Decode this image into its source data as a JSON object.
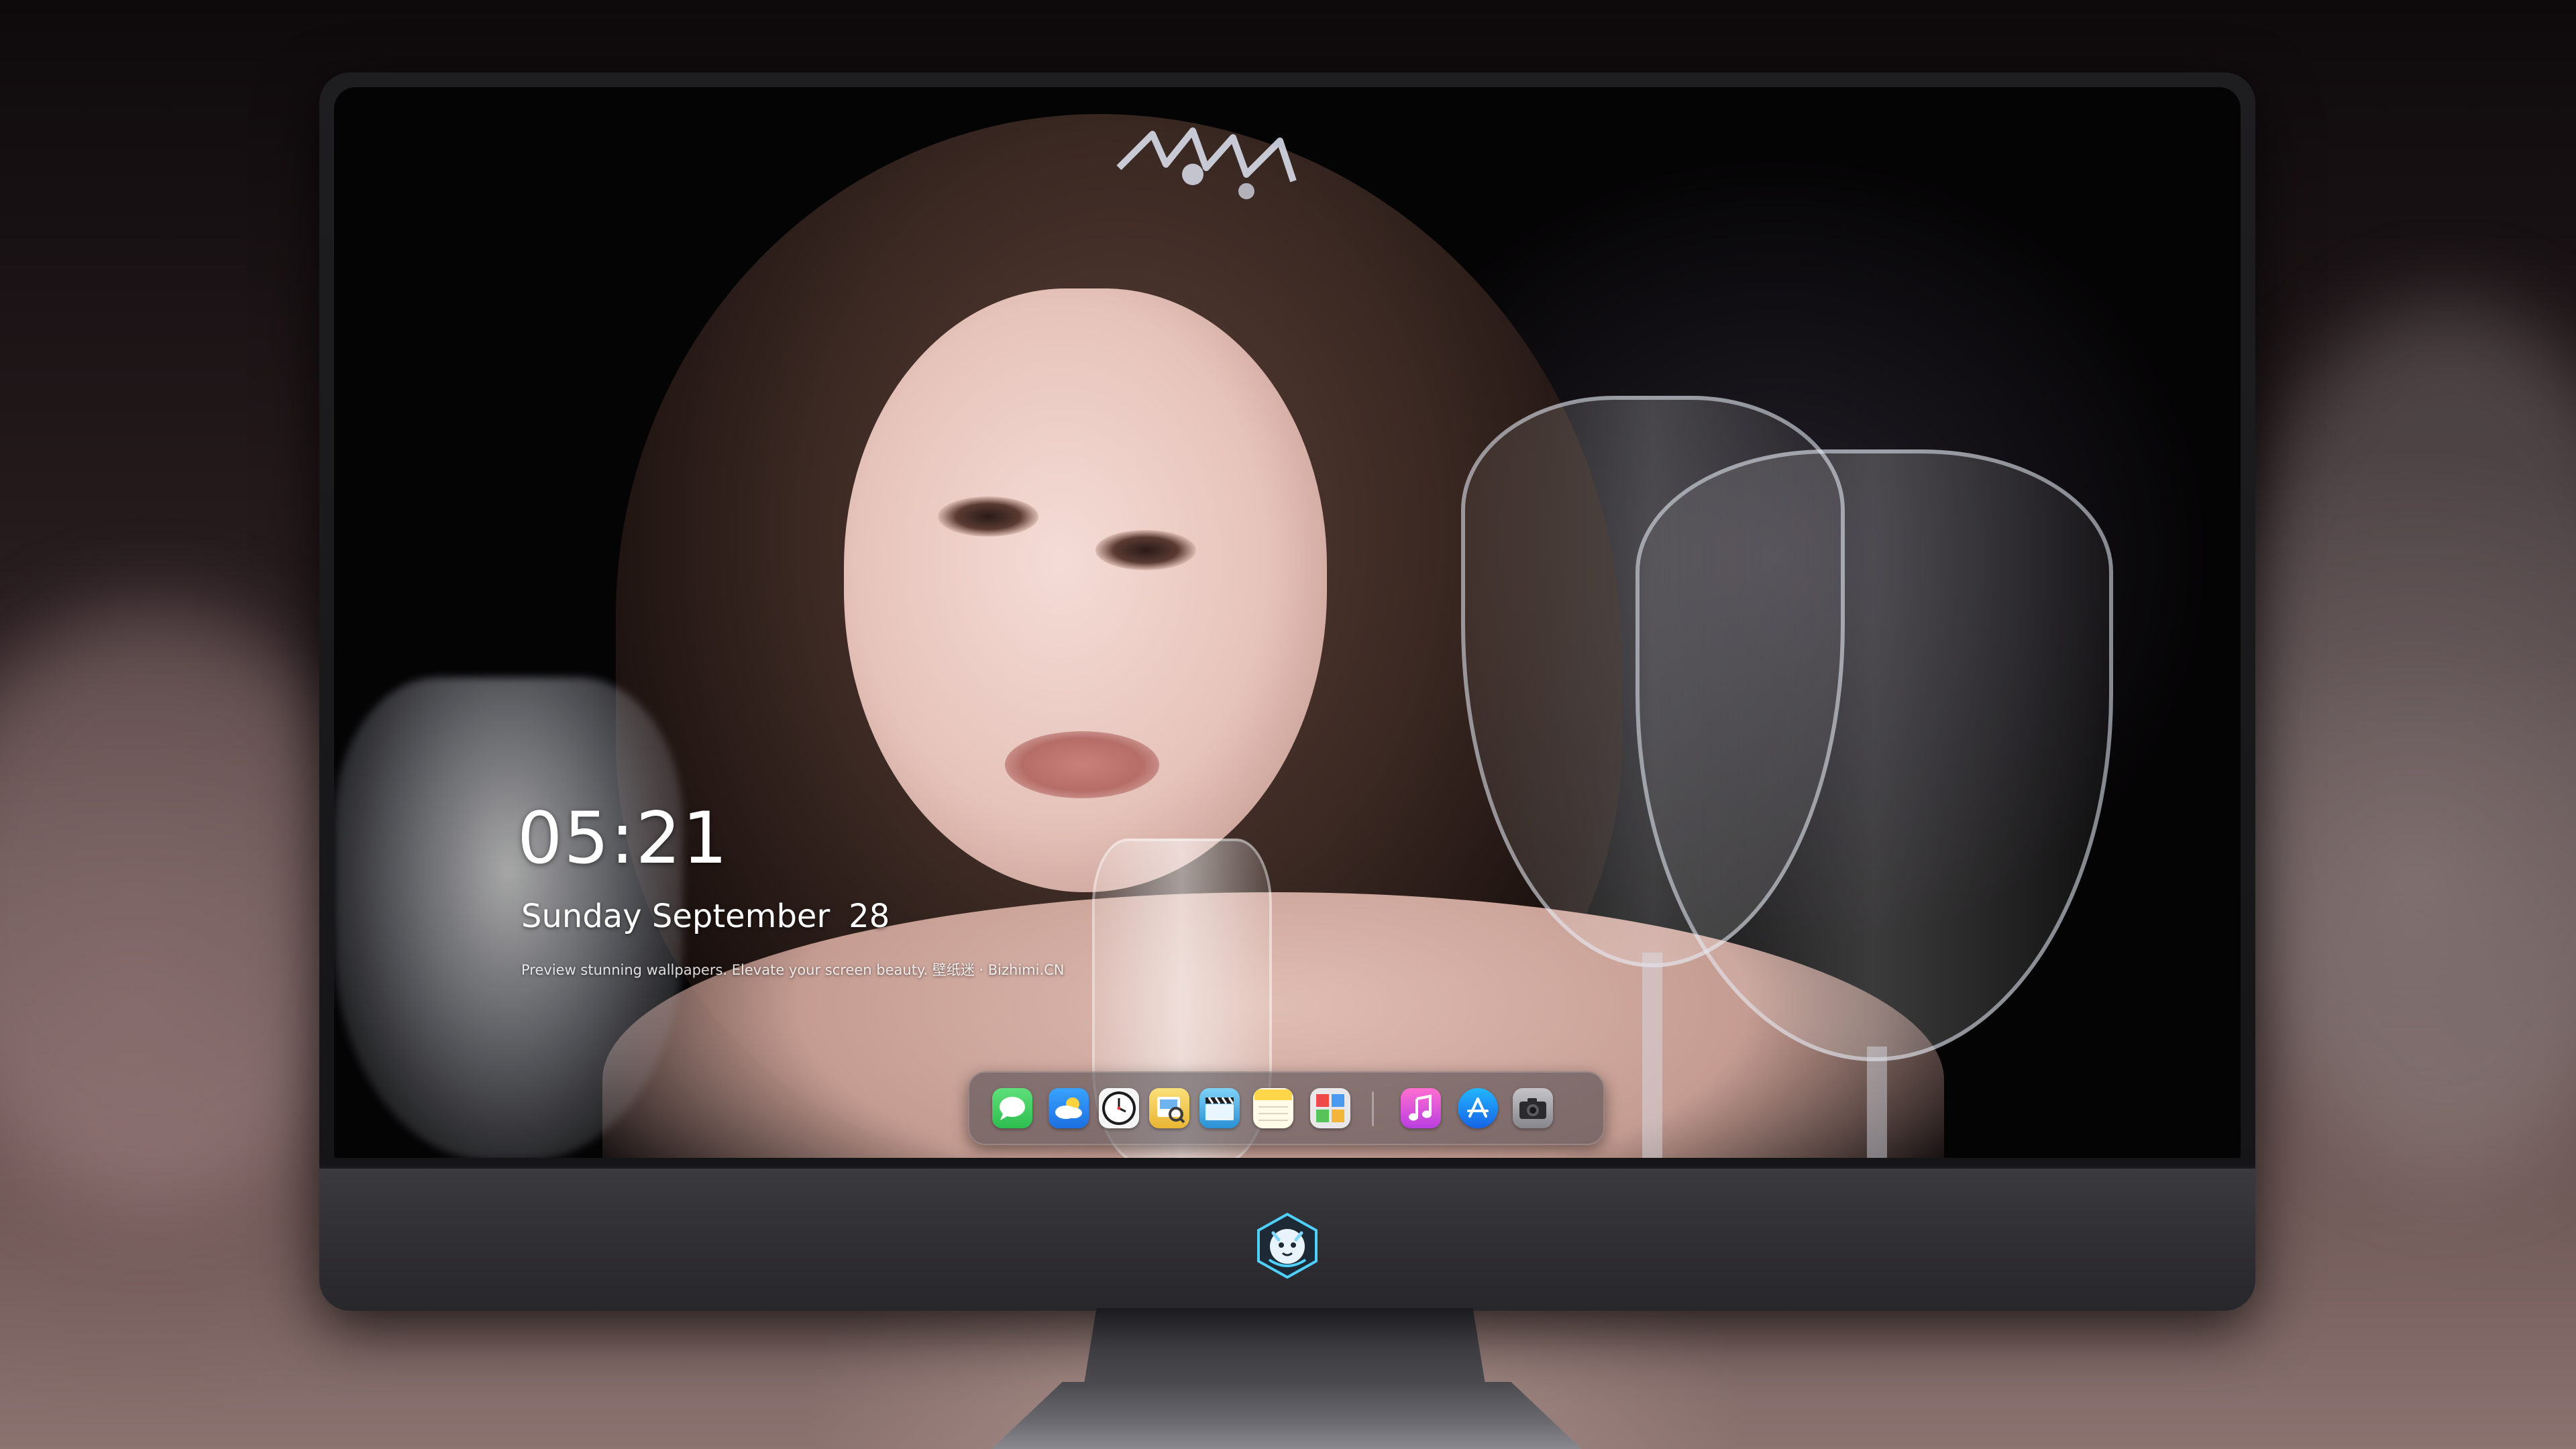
{
  "lockscreen": {
    "time": "05:21",
    "weekday_month": "Sunday September",
    "day": "28",
    "tagline": "Preview stunning wallpapers. Elevate your screen beauty. 壁纸迷 · Bizhimi.CN"
  },
  "dock": {
    "items": [
      {
        "icon": "messages-icon",
        "color": "#34c759"
      },
      {
        "icon": "weather-icon",
        "color": "#2e8cf0"
      },
      {
        "icon": "clock-icon",
        "color": "#1c1c1e"
      },
      {
        "icon": "preview-icon",
        "color": "#f4c542"
      },
      {
        "icon": "clapperboard-icon",
        "color": "#2a8fd6"
      },
      {
        "icon": "notes-icon",
        "color": "#ffd54a"
      },
      {
        "icon": "photo-booth-icon",
        "color": "#e8e8ea"
      },
      {
        "icon": "music-icon",
        "color": "#e84ab8"
      },
      {
        "icon": "app-store-icon",
        "color": "#1a8cff"
      },
      {
        "icon": "camera-icon",
        "color": "#9a9aa0"
      }
    ]
  },
  "monitor": {
    "chin_logo": "dragon-logo-icon"
  },
  "colors": {
    "bezel": "#141416",
    "chin": "#333237",
    "text": "#ffffff"
  }
}
